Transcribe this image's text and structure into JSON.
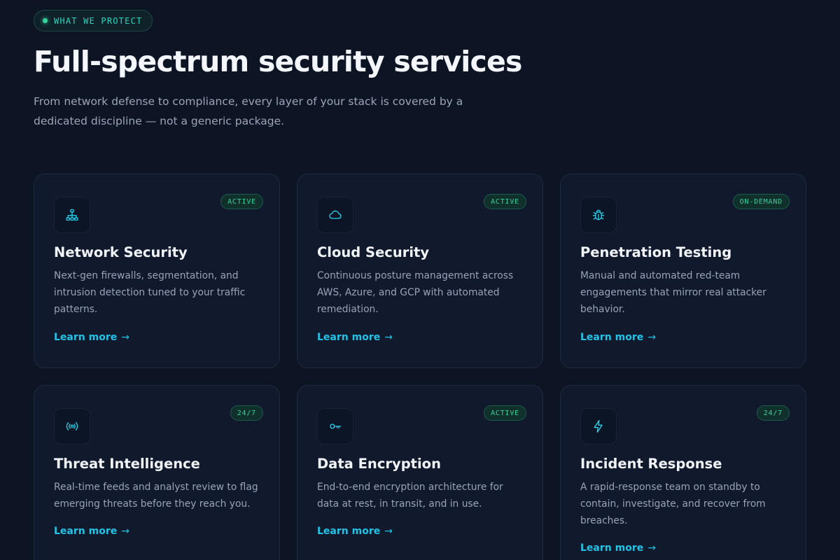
{
  "eyebrow": "WHAT WE PROTECT",
  "title": "Full-spectrum security services",
  "subtitle": "From network defense to compliance, every layer of your stack is covered by a dedicated discipline — not a generic package.",
  "colors": {
    "background": "#0d1424",
    "card": "#111a2d",
    "accent": "#22d3ee",
    "badge": "#34d399"
  },
  "cards": [
    {
      "icon": "network-icon",
      "badge": "ACTIVE",
      "title": "Network Security",
      "description": "Next-gen firewalls, segmentation, and intrusion detection tuned to your traffic patterns.",
      "link": "Learn more",
      "arrow": "→"
    },
    {
      "icon": "cloud-icon",
      "badge": "ACTIVE",
      "title": "Cloud Security",
      "description": "Continuous posture management across AWS, Azure, and GCP with automated remediation.",
      "link": "Learn more",
      "arrow": "→"
    },
    {
      "icon": "bug-icon",
      "badge": "ON-DEMAND",
      "title": "Penetration Testing",
      "description": "Manual and automated red-team engagements that mirror real attacker behavior.",
      "link": "Learn more",
      "arrow": "→"
    },
    {
      "icon": "radio-icon",
      "badge": "24/7",
      "title": "Threat Intelligence",
      "description": "Real-time feeds and analyst review to flag emerging threats before they reach you.",
      "link": "Learn more",
      "arrow": "→"
    },
    {
      "icon": "key-icon",
      "badge": "ACTIVE",
      "title": "Data Encryption",
      "description": "End-to-end encryption architecture for data at rest, in transit, and in use.",
      "link": "Learn more",
      "arrow": "→"
    },
    {
      "icon": "bolt-icon",
      "badge": "24/7",
      "title": "Incident Response",
      "description": "A rapid-response team on standby to contain, investigate, and recover from breaches.",
      "link": "Learn more",
      "arrow": "→"
    }
  ]
}
